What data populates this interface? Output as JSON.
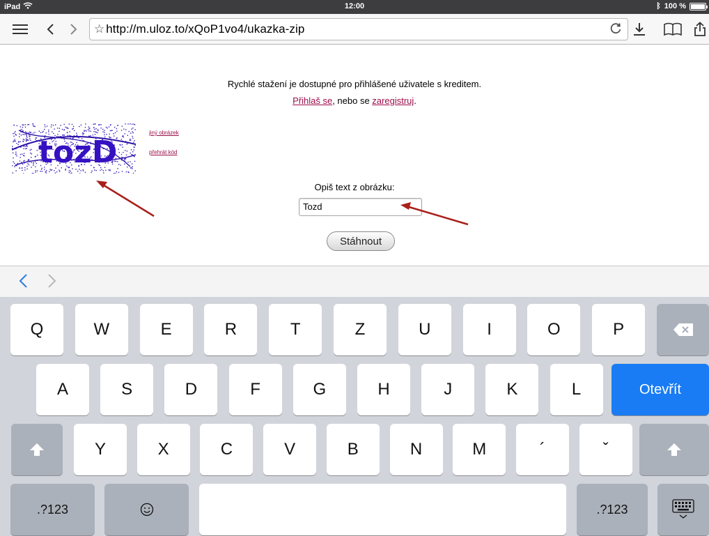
{
  "status_bar": {
    "device": "iPad",
    "time": "12:00",
    "battery": "100 %",
    "battery_level": 1.0
  },
  "browser": {
    "url": "http://m.uloz.to/xQoP1vo4/ukazka-zip",
    "icons": [
      "menu-icon",
      "back-icon",
      "forward-icon",
      "star-icon",
      "reload-icon",
      "download-icon",
      "bookmarks-icon",
      "share-icon"
    ]
  },
  "page": {
    "notice": "Rychlé stažení je dostupné pro přihlášené uživatele s kreditem.",
    "login_link": "Přihlaš se",
    "login_sep": ", nebo se ",
    "register_link": "zaregistruj",
    "login_end": ".",
    "captcha_text": "tozD",
    "other_image_link": "jiný obrázek",
    "play_code_link": "přehrát kód",
    "captcha_label": "Opiš text z obrázku:",
    "captcha_input_value": "Tozd",
    "download_button": "Stáhnout",
    "link_color": "#9c0d4a",
    "arrow_color": "#a8201a"
  },
  "keyboard": {
    "row1": [
      "Q",
      "W",
      "E",
      "R",
      "T",
      "Z",
      "U",
      "I",
      "O",
      "P"
    ],
    "row2": [
      "A",
      "S",
      "D",
      "F",
      "G",
      "H",
      "J",
      "K",
      "L"
    ],
    "row3": [
      "Y",
      "X",
      "C",
      "V",
      "B",
      "N",
      "M",
      "´",
      "ˇ"
    ],
    "open_key": "Otevřít",
    "num_key": ".?123",
    "accent_color": "#1a7cf4"
  }
}
